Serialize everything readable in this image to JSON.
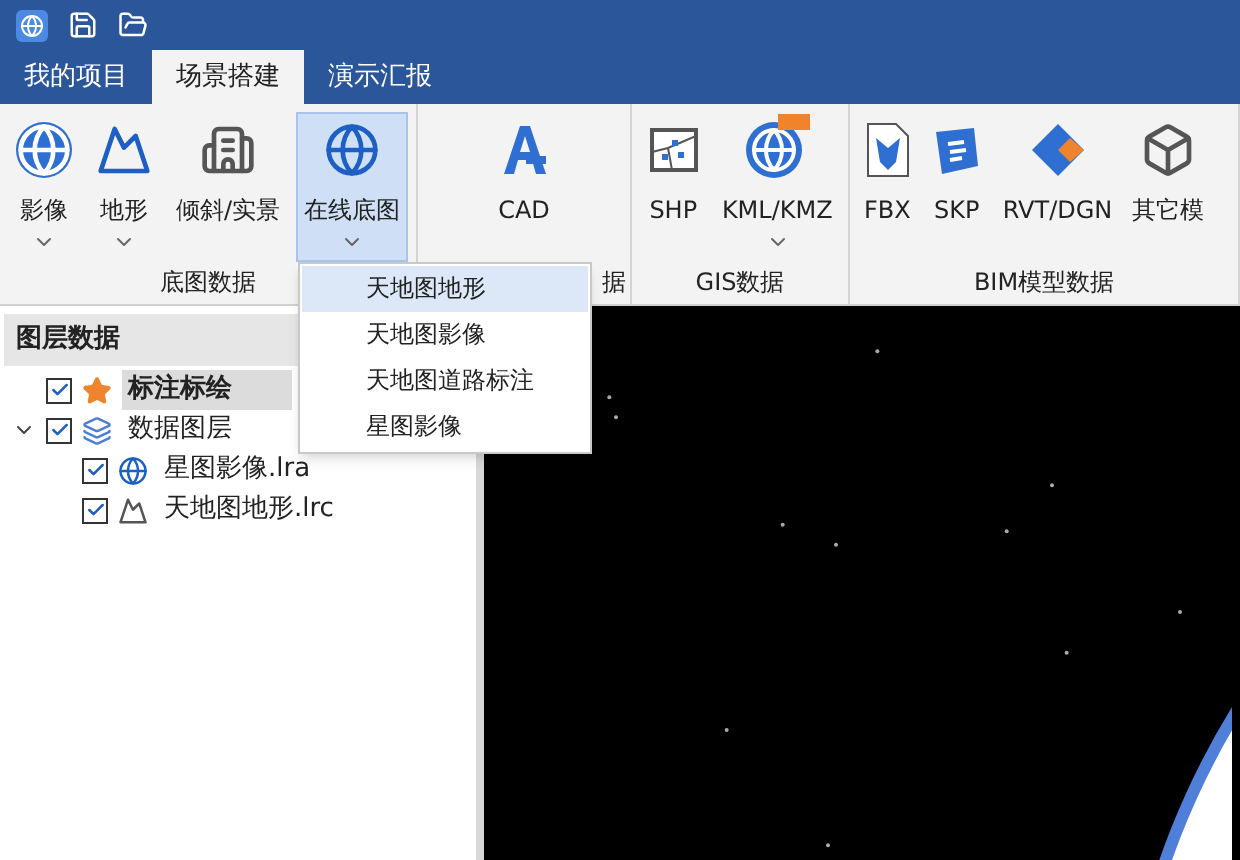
{
  "tabs": [
    {
      "label": "我的项目",
      "selected": false
    },
    {
      "label": "场景搭建",
      "selected": true
    },
    {
      "label": "演示汇报",
      "selected": false
    }
  ],
  "ribbon": {
    "groups": [
      {
        "label": "底图数据",
        "buttons": [
          {
            "label": "影像",
            "dropdown": true,
            "selected": false
          },
          {
            "label": "地形",
            "dropdown": true,
            "selected": false
          },
          {
            "label": "倾斜/实景",
            "dropdown": false,
            "selected": false
          },
          {
            "label": "在线底图",
            "dropdown": true,
            "selected": true
          }
        ]
      },
      {
        "label": "据",
        "buttons": [
          {
            "label": "CAD",
            "dropdown": false,
            "selected": false
          }
        ]
      },
      {
        "label": "GIS数据",
        "buttons": [
          {
            "label": "SHP",
            "dropdown": false,
            "selected": false
          },
          {
            "label": "KML/KMZ",
            "dropdown": true,
            "selected": false
          }
        ]
      },
      {
        "label": "BIM模型数据",
        "buttons": [
          {
            "label": "FBX",
            "dropdown": false,
            "selected": false
          },
          {
            "label": "SKP",
            "dropdown": false,
            "selected": false
          },
          {
            "label": "RVT/DGN",
            "dropdown": false,
            "selected": false
          },
          {
            "label": "其它模",
            "dropdown": false,
            "selected": false
          }
        ]
      }
    ]
  },
  "dropdown_menu": {
    "items": [
      {
        "label": "天地图地形",
        "selected": true
      },
      {
        "label": "天地图影像",
        "selected": false
      },
      {
        "label": "天地图道路标注",
        "selected": false
      },
      {
        "label": "星图影像",
        "selected": false
      }
    ]
  },
  "layer_panel": {
    "title": "图层数据",
    "items": [
      {
        "label": "标注标绘",
        "checked": true,
        "selected": true,
        "kind": "annotation"
      },
      {
        "label": "数据图层",
        "checked": true,
        "selected": false,
        "kind": "group",
        "expanded": true,
        "children": [
          {
            "label": "星图影像.lra",
            "checked": true,
            "selected": false,
            "kind": "imagery"
          },
          {
            "label": "天地图地形.lrc",
            "checked": true,
            "selected": false,
            "kind": "terrain"
          }
        ]
      }
    ]
  }
}
